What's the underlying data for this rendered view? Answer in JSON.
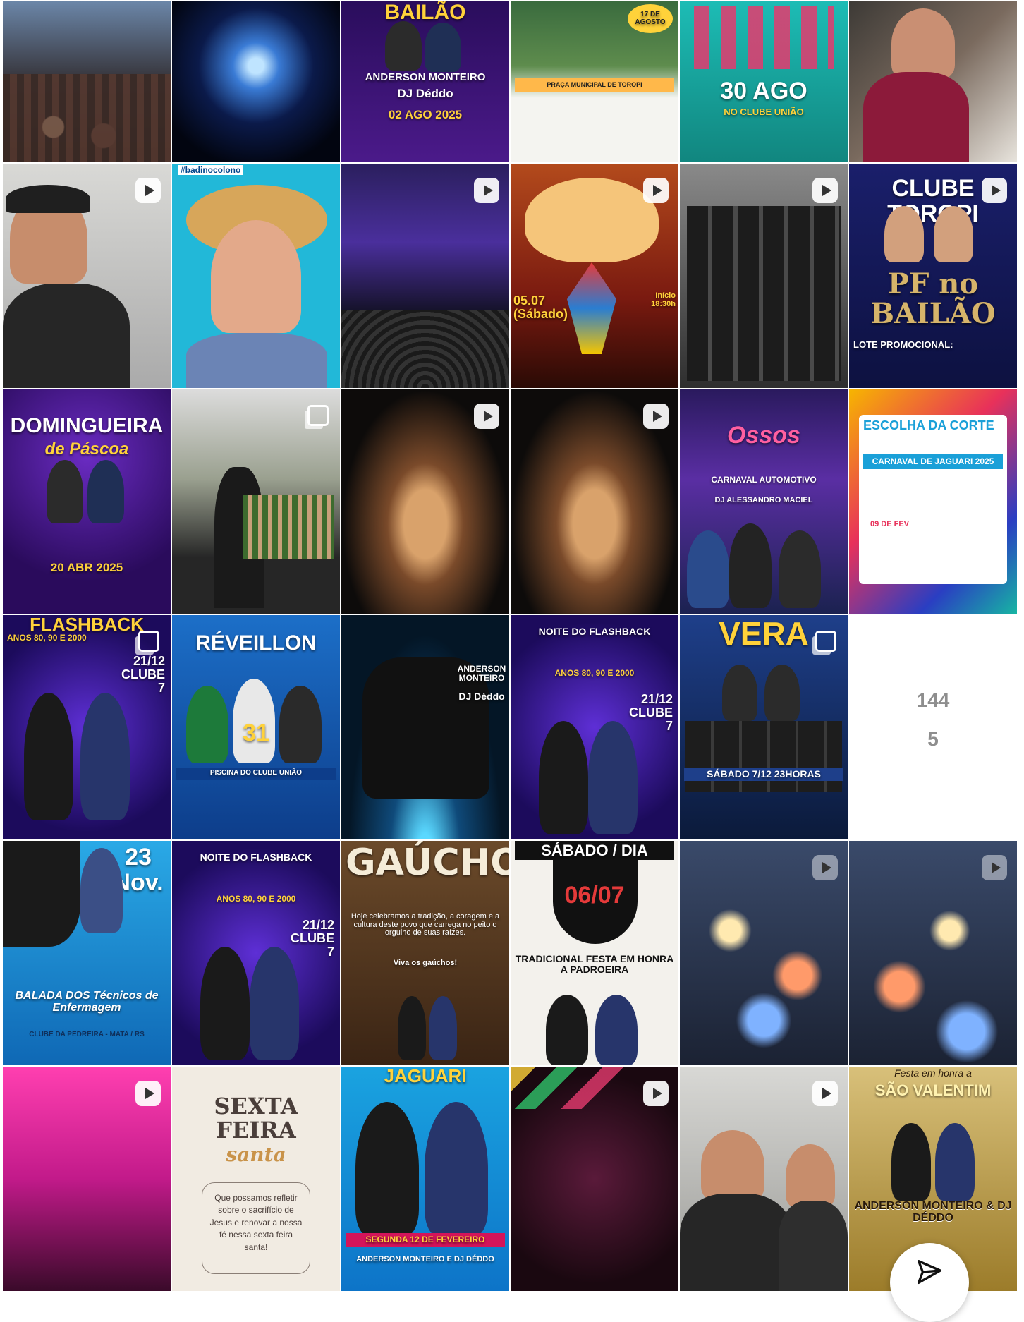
{
  "tiles": [
    {
      "caption": "",
      "kind": "post"
    },
    {
      "caption": "",
      "kind": "post"
    },
    {
      "caption": "BAILÃO",
      "line2": "ANDERSON MONTEIRO",
      "line3": "DJ Déddo",
      "line4": "02 AGO 2025",
      "kind": "post"
    },
    {
      "caption": "17 DE AGOSTO",
      "line2": "PRAÇA MUNICIPAL DE TOROPI",
      "kind": "post"
    },
    {
      "caption": "30 AGO",
      "line2": "NO CLUBE UNIÃO",
      "kind": "post"
    },
    {
      "caption": "",
      "kind": "post"
    },
    {
      "caption": "",
      "kind": "reel"
    },
    {
      "caption": "#badinocolono",
      "kind": "post"
    },
    {
      "caption": "",
      "kind": "reel"
    },
    {
      "caption": "05.07 (Sábado)",
      "line2": "Início 18:30h",
      "kind": "reel"
    },
    {
      "caption": "",
      "kind": "reel"
    },
    {
      "caption": "CLUBE TOROPI",
      "line2": "PF no BAILÃO",
      "line3": "LOTE PROMOCIONAL:",
      "kind": "reel"
    },
    {
      "caption": "DOMINGUEIRA",
      "line2": "de Páscoa",
      "line3": "20 ABR 2025",
      "kind": "post"
    },
    {
      "caption": "",
      "kind": "carousel"
    },
    {
      "caption": "",
      "kind": "reel"
    },
    {
      "caption": "",
      "kind": "reel"
    },
    {
      "caption": "Ossos",
      "line2": "CARNAVAL AUTOMOTIVO",
      "line3": "DJ ALESSANDRO MACIEL",
      "kind": "post"
    },
    {
      "caption": "ESCOLHA DA CORTE",
      "line2": "CARNAVAL DE JAGUARI 2025",
      "line3": "09 DE FEV",
      "kind": "post"
    },
    {
      "caption": "FLASHBACK",
      "line2": "ANOS 80, 90 E 2000",
      "line3": "21/12 CLUBE 7",
      "kind": "post"
    },
    {
      "caption": "RÉVEILLON",
      "line2": "31",
      "line3": "PISCINA DO CLUBE UNIÃO",
      "kind": "post"
    },
    {
      "caption": "ANDERSON MONTEIRO",
      "line2": "DJ Déddo",
      "kind": "post"
    },
    {
      "caption": "NOITE DO FLASHBACK",
      "line2": "ANOS 80, 90 E 2000",
      "line3": "21/12 CLUBE 7",
      "kind": "post"
    },
    {
      "caption": "VERA",
      "line2": "SÁBADO 7/12 23HORAS",
      "kind": "post"
    },
    {
      "caption": "",
      "kind": "counter"
    },
    {
      "caption": "23 Nov.",
      "line2": "BALADA DOS Técnicos de Enfermagem",
      "line3": "CLUBE DA PEDREIRA - MATA / RS",
      "kind": "post"
    },
    {
      "caption": "NOITE DO FLASHBACK",
      "line2": "ANOS 80, 90 E 2000",
      "line3": "21/12 CLUBE 7",
      "kind": "post"
    },
    {
      "caption": "GAÚCHO",
      "line2": "Hoje celebramos a tradição, a coragem e a cultura deste povo que carrega no peito o orgulho de suas raízes.",
      "line3": "Viva os gaúchos!",
      "kind": "post"
    },
    {
      "caption": "SÁBADO / DIA",
      "line2": "06/07",
      "line3": "TRADICIONAL FESTA EM HONRA A PADROEIRA",
      "kind": "post"
    },
    {
      "caption": "",
      "kind": "reel-faded"
    },
    {
      "caption": "",
      "kind": "reel-faded"
    },
    {
      "caption": "",
      "kind": "reel"
    },
    {
      "caption": "SEXTA FEIRA",
      "line2": "santa",
      "line3": "Que possamos refletir sobre o sacrifício de Jesus e renovar a nossa fé nessa sexta feira santa!",
      "kind": "post"
    },
    {
      "caption": "JAGUARI",
      "line2": "SEGUNDA 12 DE FEVEREIRO",
      "line3": "ANDERSON MONTEIRO E DJ DÉDDO",
      "kind": "post"
    },
    {
      "caption": "",
      "kind": "reel"
    },
    {
      "caption": "",
      "kind": "reel"
    },
    {
      "caption": "Festa em honra a",
      "line2": "SÃO VALENTIM",
      "line3": "ANDERSON MONTEIRO & DJ DÉDDO",
      "kind": "post"
    }
  ],
  "counter": {
    "top": "144",
    "bottom": "5"
  },
  "fab": {
    "icon": "filter-icon"
  }
}
